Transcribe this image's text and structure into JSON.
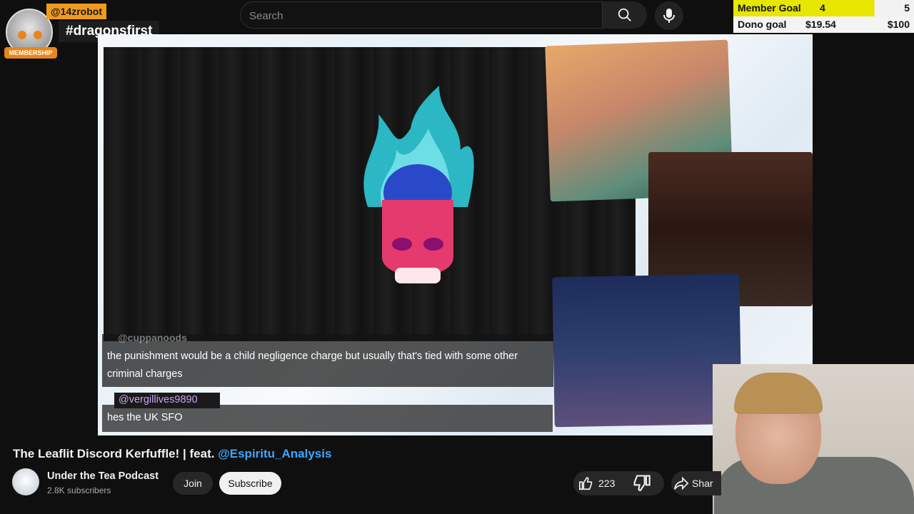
{
  "search": {
    "placeholder": "Search"
  },
  "overlay": {
    "member_handle": "@14zrobot",
    "member_badge": "MEMBERSHIP",
    "tag": "#dragonsfirst"
  },
  "goals": {
    "member_goal_label": "Member Goal",
    "member_goal_current": "4",
    "member_goal_target": "5",
    "dono_goal_label": "Dono goal",
    "dono_goal_current": "$19.54",
    "dono_goal_target": "$100"
  },
  "chat": [
    {
      "user": "@cuppanoods",
      "text": "the punishment would be a child negligence charge but usually that's tied with some other criminal charges"
    },
    {
      "user": "@vergillives9890",
      "text": "hes the UK SFO"
    }
  ],
  "video": {
    "title_prefix": "The Leaflit Discord Kerfuffle! | feat. ",
    "title_mention": "@Espiritu_Analysis"
  },
  "channel": {
    "name": "Under the Tea Podcast",
    "subscribers": "2.8K subscribers",
    "join_label": "Join",
    "subscribe_label": "Subscribe"
  },
  "actions": {
    "like_count": "223",
    "share_label": "Shar"
  },
  "colors": {
    "accent_link": "#3ea6ff",
    "goal_bar": "#e6e600",
    "member_orange": "#f09a1e"
  }
}
